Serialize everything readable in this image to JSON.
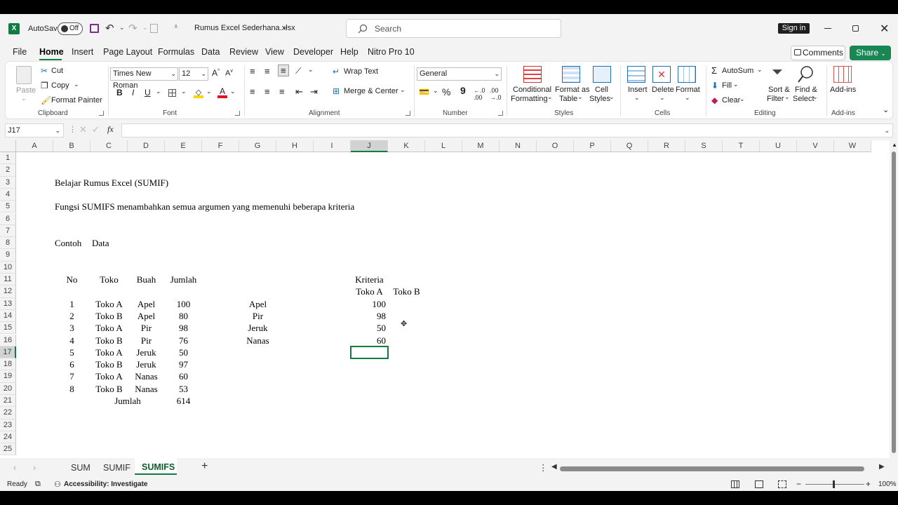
{
  "titlebar": {
    "autosave_label": "AutoSave",
    "autosave_state": "Off",
    "filename": "Rumus Excel Sederhana.xlsx",
    "search_placeholder": "Search",
    "signin_label": "Sign in"
  },
  "menu": {
    "items": [
      "File",
      "Home",
      "Insert",
      "Page Layout",
      "Formulas",
      "Data",
      "Review",
      "View",
      "Developer",
      "Help",
      "Nitro Pro 10"
    ],
    "comments_label": "Comments",
    "share_label": "Share"
  },
  "ribbon": {
    "clipboard": {
      "paste": "Paste",
      "cut": "Cut",
      "copy": "Copy",
      "format_painter": "Format Painter",
      "label": "Clipboard"
    },
    "font": {
      "name": "Times New Roman",
      "size": "12",
      "bold": "B",
      "italic": "I",
      "underline": "U",
      "label": "Font"
    },
    "alignment": {
      "wrap_text": "Wrap Text",
      "merge_center": "Merge & Center",
      "label": "Alignment"
    },
    "number": {
      "format": "General",
      "percent": "%",
      "comma": "9",
      "label": "Number"
    },
    "styles": {
      "conditional": "Conditional",
      "conditional2": "Formatting",
      "format_table": "Format as",
      "format_table2": "Table",
      "cell_styles": "Cell",
      "cell_styles2": "Styles",
      "label": "Styles"
    },
    "cells": {
      "insert": "Insert",
      "delete": "Delete",
      "format": "Format",
      "label": "Cells"
    },
    "editing": {
      "autosum": "AutoSum",
      "fill": "Fill",
      "clear": "Clear",
      "sort_filter": "Sort &",
      "sort_filter2": "Filter",
      "find_select": "Find &",
      "find_select2": "Select",
      "label": "Editing"
    },
    "addins": {
      "addins": "Add-ins",
      "label": "Add-ins"
    }
  },
  "formula_bar": {
    "name_box": "J17",
    "fx": "fx",
    "formula": ""
  },
  "columns": [
    "A",
    "B",
    "C",
    "D",
    "E",
    "F",
    "G",
    "H",
    "I",
    "J",
    "K",
    "L",
    "M",
    "N",
    "O",
    "P",
    "Q",
    "R",
    "S",
    "T",
    "U",
    "V",
    "W"
  ],
  "rows": [
    "1",
    "2",
    "3",
    "4",
    "5",
    "6",
    "7",
    "8",
    "9",
    "10",
    "11",
    "12",
    "13",
    "14",
    "15",
    "16",
    "17",
    "18",
    "19",
    "20",
    "21",
    "22",
    "23",
    "24",
    "25"
  ],
  "selected_cell": "J17",
  "sheet": {
    "title": "Belajar Rumus Excel (SUMIF)",
    "description": "Fungsi SUMIFS menambahkan semua argumen yang memenuhi beberapa kriteria",
    "contoh": "Contoh",
    "data_label": "Data",
    "headers": [
      "No",
      "Toko",
      "Buah",
      "Jumlah"
    ],
    "table": [
      [
        "1",
        "Toko A",
        "Apel",
        "100"
      ],
      [
        "2",
        "Toko B",
        "Apel",
        "80"
      ],
      [
        "3",
        "Toko A",
        "Pir",
        "98"
      ],
      [
        "4",
        "Toko B",
        "Pir",
        "76"
      ],
      [
        "5",
        "Toko A",
        "Jeruk",
        "50"
      ],
      [
        "6",
        "Toko B",
        "Jeruk",
        "97"
      ],
      [
        "7",
        "Toko A",
        "Nanas",
        "60"
      ],
      [
        "8",
        "Toko B",
        "Nanas",
        "53"
      ]
    ],
    "total_label": "Jumlah",
    "total_value": "614",
    "kriteria_label": "Kriteria",
    "kriteria_cols": [
      "Toko A",
      "Toko B"
    ],
    "kriteria_items": [
      "Apel",
      "Pir",
      "Jeruk",
      "Nanas"
    ],
    "kriteria_toko_a": [
      "100",
      "98",
      "50",
      "60"
    ]
  },
  "tabs": {
    "items": [
      "SUM",
      "SUMIF",
      "SUMIFS"
    ],
    "active": "SUMIFS"
  },
  "status": {
    "ready": "Ready",
    "accessibility": "Accessibility: Investigate",
    "zoom": "100%"
  },
  "colors": {
    "accent": "#107c41",
    "share": "#198754"
  }
}
